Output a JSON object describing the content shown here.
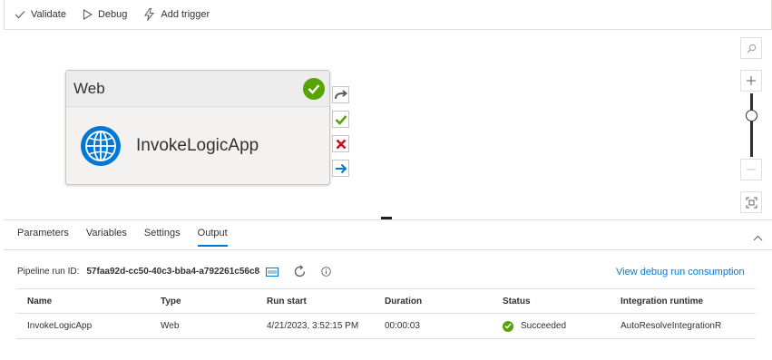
{
  "toolbar": {
    "validate_label": "Validate",
    "debug_label": "Debug",
    "add_trigger_label": "Add trigger"
  },
  "activity": {
    "type_label": "Web",
    "name": "InvokeLogicApp",
    "icon": "globe-icon",
    "status": "succeeded"
  },
  "tabs": [
    {
      "label": "Parameters",
      "active": false
    },
    {
      "label": "Variables",
      "active": false
    },
    {
      "label": "Settings",
      "active": false
    },
    {
      "label": "Output",
      "active": true
    }
  ],
  "run": {
    "label": "Pipeline run ID:",
    "id": "57faa92d-cc50-40c3-bba4-a792261c56c8",
    "link": "View debug run consumption"
  },
  "grid": {
    "headers": [
      "Name",
      "Type",
      "Run start",
      "Duration",
      "Status",
      "Integration runtime"
    ],
    "rows": [
      {
        "name": "InvokeLogicApp",
        "type": "Web",
        "run_start": "4/21/2023, 3:52:15 PM",
        "duration": "00:00:03",
        "status": "Succeeded",
        "runtime": "AutoResolveIntegrationR"
      }
    ]
  },
  "colors": {
    "accent": "#0078d4",
    "success": "#57a300",
    "failure": "#c50f1f"
  }
}
